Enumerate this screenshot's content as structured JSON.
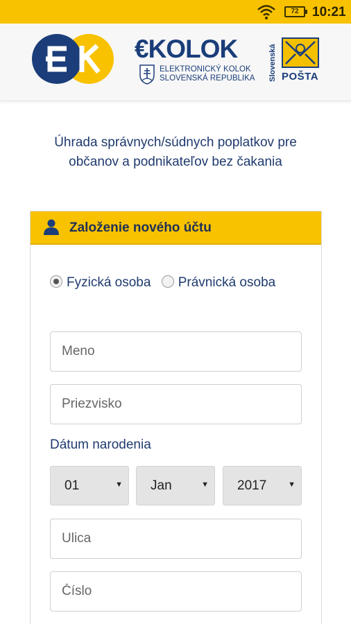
{
  "status_bar": {
    "battery": "72",
    "time": "10:21"
  },
  "header": {
    "logo_letters": "EK",
    "brand_name": "KOLOK",
    "brand_sub_line1": "ELEKTRONICKÝ KOLOK",
    "brand_sub_line2": "SLOVENSKÁ REPUBLIKA",
    "posta_vertical": "Slovenská",
    "posta_word": "POŠTA"
  },
  "intro": {
    "line1": "Úhrada správnych/súdnych poplatkov pre",
    "line2": "občanov a podnikateľov bez čakania"
  },
  "form": {
    "title": "Založenie nového účtu",
    "radio_physical": "Fyzická osoba",
    "radio_legal": "Právnická osoba",
    "first_name_placeholder": "Meno",
    "last_name_placeholder": "Priezvisko",
    "dob_label": "Dátum narodenia",
    "dob_day": "01",
    "dob_month": "Jan",
    "dob_year": "2017",
    "street_placeholder": "Ulica",
    "number_placeholder": "Číslo"
  },
  "colors": {
    "accent": "#f8c200",
    "brand": "#1b3e7a",
    "text": "#1f3a6e"
  }
}
